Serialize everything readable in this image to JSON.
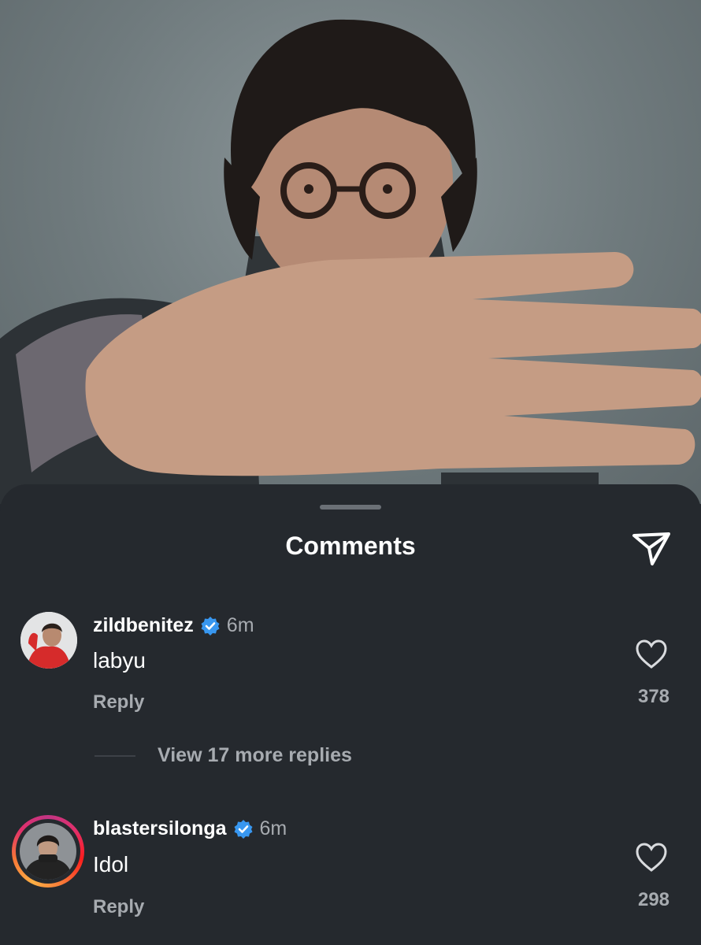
{
  "sheet": {
    "title": "Comments",
    "share_icon": "send-icon"
  },
  "comments": [
    {
      "username": "zildbenitez",
      "verified": true,
      "time": "6m",
      "text": "labyu",
      "reply_label": "Reply",
      "likes": "378",
      "view_replies": "View 17 more replies"
    },
    {
      "username": "blastersilonga",
      "verified": true,
      "time": "6m",
      "text": "Idol",
      "reply_label": "Reply",
      "likes": "298",
      "has_story_ring": true
    }
  ],
  "colors": {
    "sheet_bg": "#25292e",
    "verified_blue": "#3897f0",
    "muted_text": "#a7abb0"
  }
}
